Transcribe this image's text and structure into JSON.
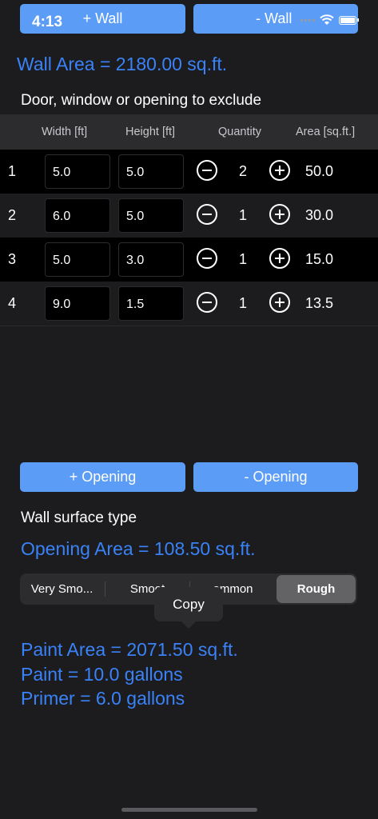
{
  "status_bar": {
    "time": "4:13"
  },
  "top_buttons": {
    "add_wall": "+ Wall",
    "remove_wall": "- Wall"
  },
  "wall_area": "Wall Area = 2180.00 sq.ft.",
  "exclude_heading": "Door, window or opening to exclude",
  "table": {
    "headers": [
      "Width [ft]",
      "Height [ft]",
      "Quantity",
      "Area [sq.ft.]"
    ],
    "rows": [
      {
        "index": "1",
        "width": "5.0",
        "height": "5.0",
        "quantity": "2",
        "area": "50.0"
      },
      {
        "index": "2",
        "width": "6.0",
        "height": "5.0",
        "quantity": "1",
        "area": "30.0"
      },
      {
        "index": "3",
        "width": "5.0",
        "height": "3.0",
        "quantity": "1",
        "area": "15.0"
      },
      {
        "index": "4",
        "width": "9.0",
        "height": "1.5",
        "quantity": "1",
        "area": "13.5"
      }
    ]
  },
  "opening_buttons": {
    "add_opening": "+ Opening",
    "remove_opening": "- Opening"
  },
  "surface_type_label": "Wall surface type",
  "opening_area": "Opening Area = 108.50 sq.ft.",
  "surface_segments": {
    "options": [
      "Very Smo...",
      "Smoot",
      "ommon",
      "Rough"
    ],
    "selected": "Rough"
  },
  "copy_popup": "Copy",
  "results": {
    "paint_area": "Paint Area = 2071.50 sq.ft.",
    "paint": "Paint = 10.0 gallons",
    "primer": "Primer = 6.0 gallons"
  },
  "colors": {
    "accent": "#3a82f7",
    "button": "#5b9cf6",
    "background": "#1c1c1e"
  }
}
